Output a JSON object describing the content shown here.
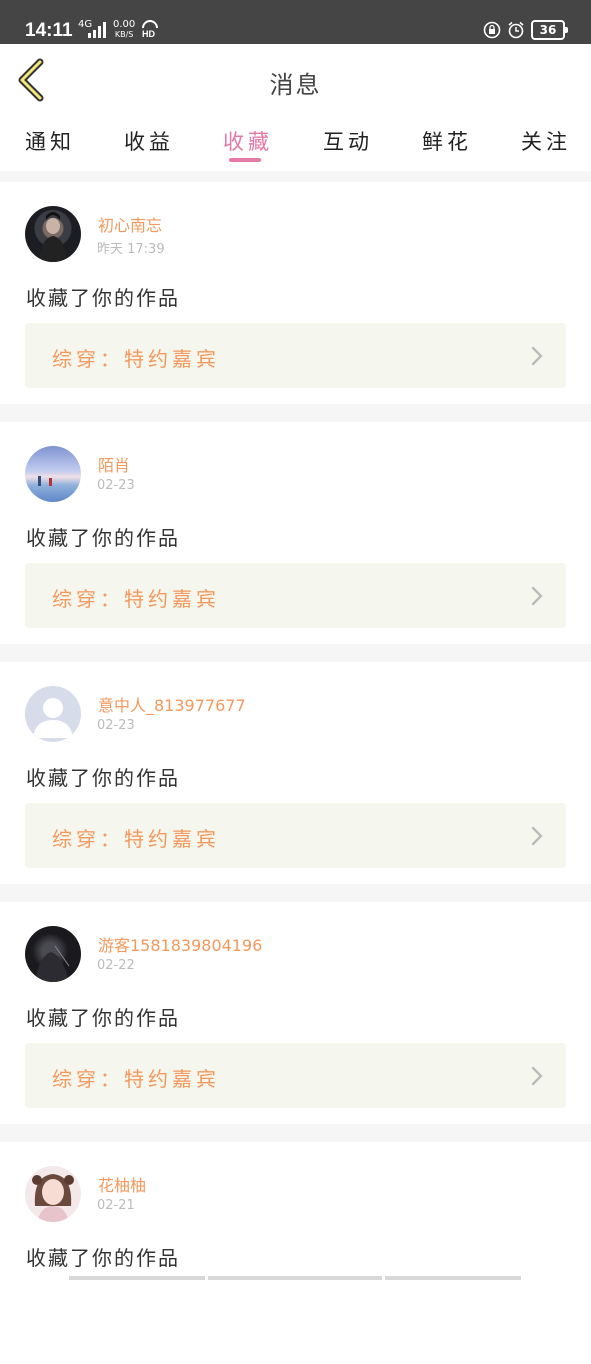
{
  "status_bar": {
    "time": "14:11",
    "network_top": "4G",
    "network_prefix": "46",
    "speed_value": "0.00",
    "speed_unit": "KB/S",
    "hd": "HD",
    "battery": "36"
  },
  "header": {
    "title": "消息"
  },
  "tabs": [
    {
      "label": "通知"
    },
    {
      "label": "收益"
    },
    {
      "label": "收藏"
    },
    {
      "label": "互动"
    },
    {
      "label": "鲜花"
    },
    {
      "label": "关注"
    }
  ],
  "active_tab": "收藏",
  "messages": [
    {
      "username": "初心南忘",
      "time": "昨天 17:39",
      "action": "收藏了你的作品",
      "work": "综穿：特约嘉宾",
      "avatar_color": "#2a2d33"
    },
    {
      "username": "陌肖",
      "time": "02-23",
      "action": "收藏了你的作品",
      "work": "综穿：特约嘉宾",
      "avatar_color": "#9fb3d9"
    },
    {
      "username": "意中人_813977677",
      "time": "02-23",
      "action": "收藏了你的作品",
      "work": "综穿：特约嘉宾",
      "avatar_color": "#d5dbe8"
    },
    {
      "username": "游客1581839804196",
      "time": "02-22",
      "action": "收藏了你的作品",
      "work": "综穿：特约嘉宾",
      "avatar_color": "#1e1e22"
    },
    {
      "username": "花柚柚",
      "time": "02-21",
      "action": "收藏了你的作品",
      "work": "综穿：特约嘉宾",
      "avatar_color": "#e9d6d8"
    }
  ],
  "colors": {
    "accent_pink": "#e579a8",
    "name_orange": "#f3995d",
    "link_bg": "#f5f6ee"
  }
}
